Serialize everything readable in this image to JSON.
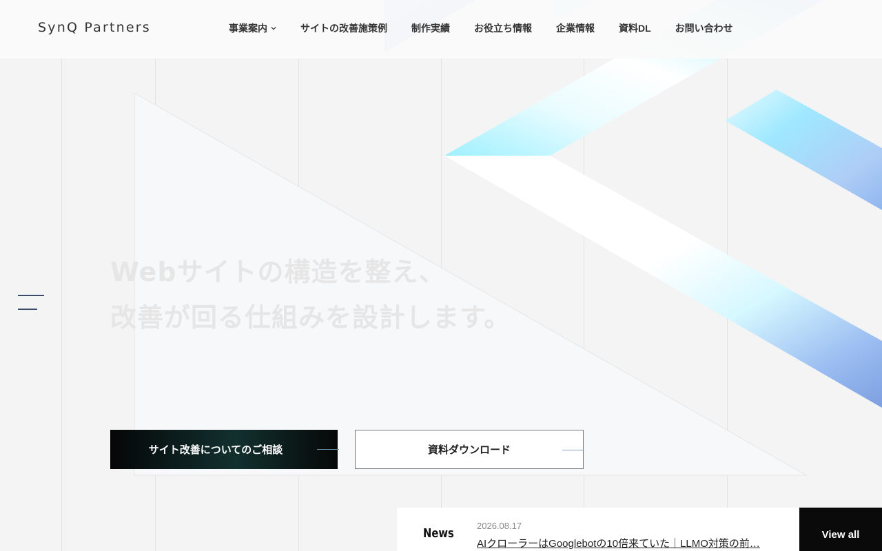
{
  "brand": {
    "logo_text": "SynQ Partners"
  },
  "nav": {
    "items": [
      {
        "label": "事業案内",
        "has_dropdown": true
      },
      {
        "label": "サイトの改善施策例",
        "has_dropdown": false
      },
      {
        "label": "制作実績",
        "has_dropdown": false
      },
      {
        "label": "お役立ち情報",
        "has_dropdown": false
      },
      {
        "label": "企業情報",
        "has_dropdown": false
      },
      {
        "label": "資料DL",
        "has_dropdown": false
      },
      {
        "label": "お問い合わせ",
        "has_dropdown": false
      }
    ]
  },
  "hero": {
    "headline_line1": "Webサイトの構造を整え、",
    "headline_line2": "改善が回る仕組みを設計します。"
  },
  "cta": {
    "consult_label": "サイト改善についてのご相談",
    "download_label": "資料ダウンロード"
  },
  "news": {
    "heading": "News",
    "date": "2026.08.17",
    "headline": "AIクローラーはGooglebotの10倍来ていた｜LLMO対策の前…",
    "view_all_label": "View all"
  },
  "icons": {
    "menu": "hamburger-menu-icon",
    "dropdown": "chevron-down-icon"
  },
  "colors": {
    "background": "#f4f4f4",
    "primary_button": "#0a0a0a",
    "accent_blue": "#7aa0e8",
    "accent_cyan": "#c9f6ff"
  }
}
